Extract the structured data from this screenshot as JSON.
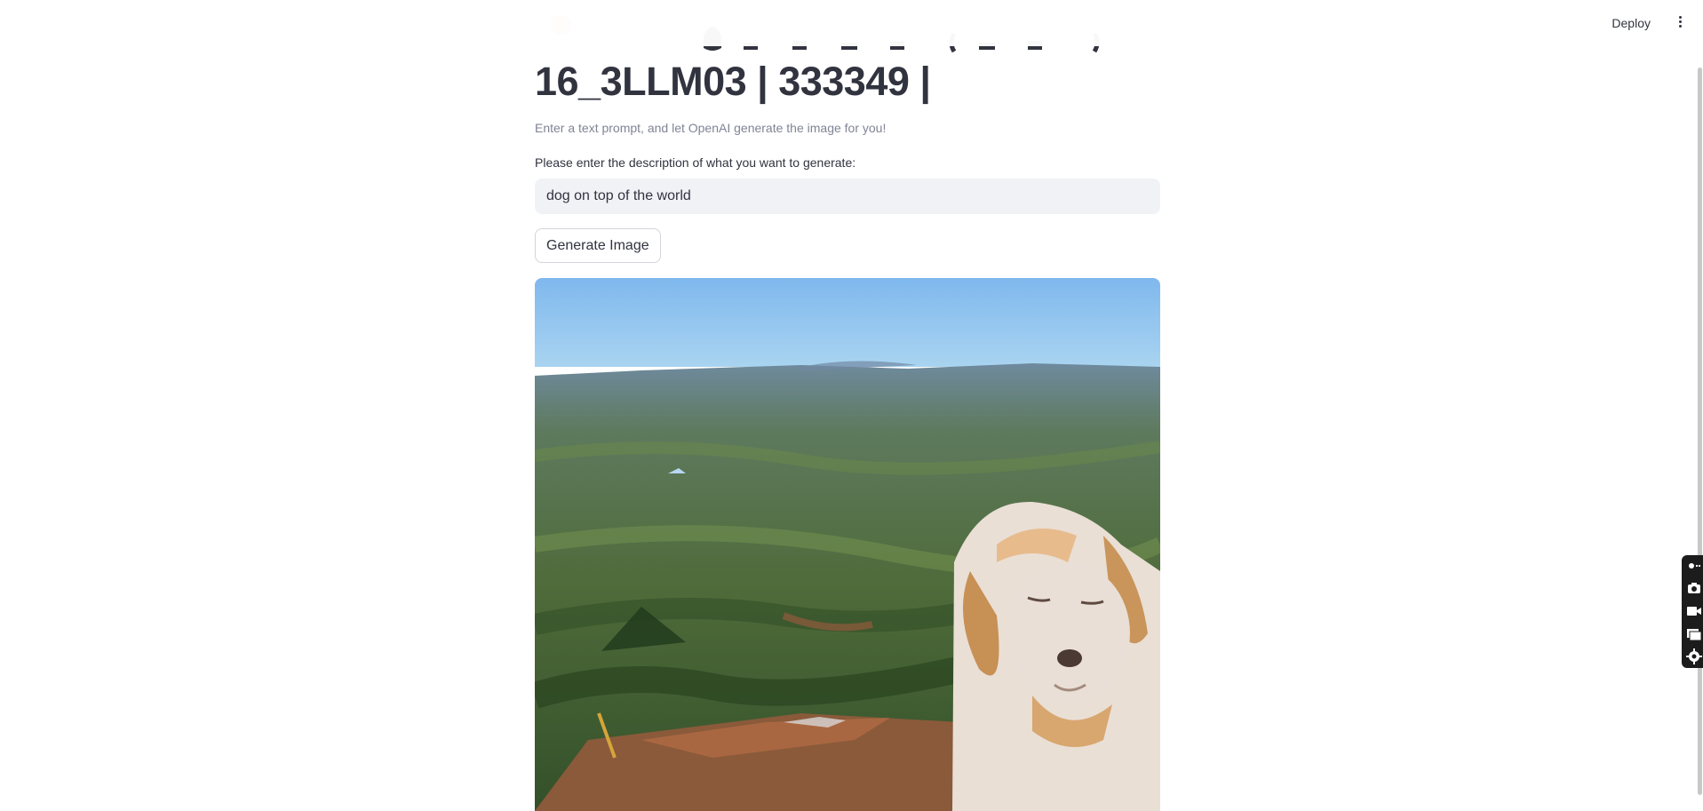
{
  "header": {
    "deploy_label": "Deploy",
    "menu_icon": "kebab-menu-icon"
  },
  "main": {
    "title": "16_3LLM03 | 333349 |",
    "subtitle": "Enter a text prompt, and let OpenAI generate the image for you!",
    "prompt_label": "Please enter the description of what you want to generate:",
    "prompt_value": "dog on top of the world",
    "generate_button_label": "Generate Image"
  },
  "toolbar": {
    "icons": [
      "pin-icon",
      "camera-icon",
      "video-icon",
      "windows-icon",
      "gear-icon"
    ]
  },
  "colors": {
    "text": "#31333f",
    "muted": "#808495",
    "input_bg": "#f0f2f6",
    "button_border": "#d3d5db"
  }
}
